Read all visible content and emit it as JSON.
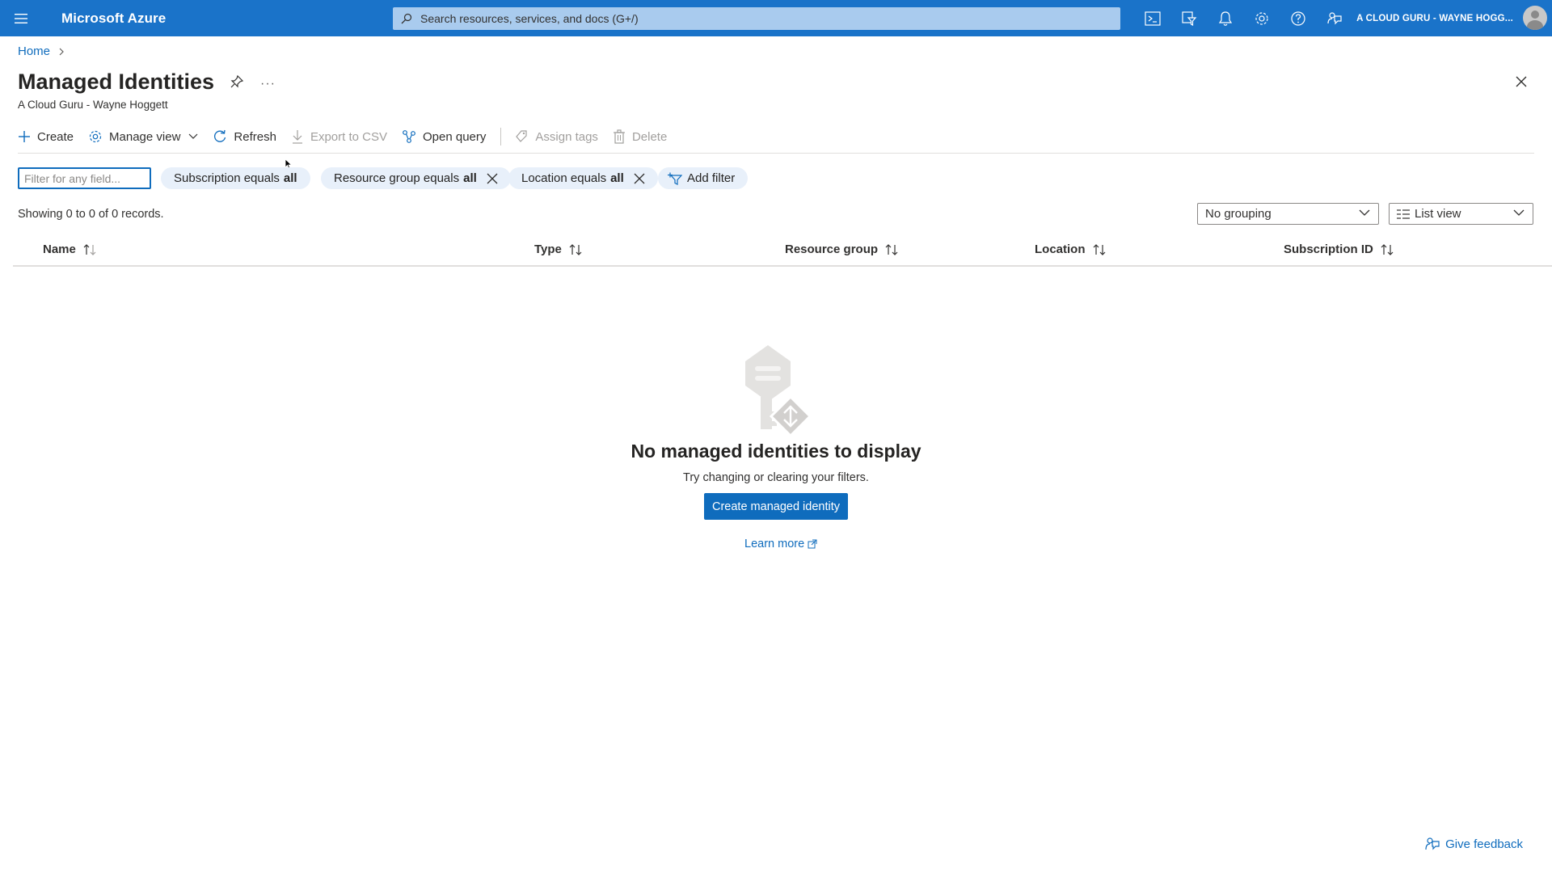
{
  "topbar": {
    "brand": "Microsoft Azure",
    "search_placeholder": "Search resources, services, and docs (G+/)",
    "account": "A CLOUD GURU - WAYNE HOGG...",
    "icons": [
      "cloud-shell-icon",
      "directory-filter-icon",
      "notifications-icon",
      "settings-icon",
      "help-icon",
      "feedback-icon"
    ]
  },
  "breadcrumb": {
    "home": "Home"
  },
  "page": {
    "title": "Managed Identities",
    "subtitle": "A Cloud Guru - Wayne Hoggett",
    "more": "···"
  },
  "commands": {
    "create": "Create",
    "manage_view": "Manage view",
    "refresh": "Refresh",
    "export_csv": "Export to CSV",
    "open_query": "Open query",
    "assign_tags": "Assign tags",
    "delete": "Delete"
  },
  "filters": {
    "placeholder": "Filter for any field...",
    "subscription_label": "Subscription equals",
    "subscription_value": "all",
    "resource_group_label": "Resource group equals",
    "resource_group_value": "all",
    "location_label": "Location equals",
    "location_value": "all",
    "add_filter": "Add filter"
  },
  "records": "Showing 0 to 0 of 0 records.",
  "grouping": {
    "selected": "No grouping"
  },
  "view": {
    "selected": "List view"
  },
  "columns": [
    "Name",
    "Type",
    "Resource group",
    "Location",
    "Subscription ID"
  ],
  "empty_state": {
    "title": "No managed identities to display",
    "subtitle": "Try changing or clearing your filters.",
    "button": "Create managed identity",
    "learn_more": "Learn more"
  },
  "feedback": "Give feedback",
  "colors": {
    "topbar": "#1a73c9",
    "accent": "#0f6cbd",
    "pill_bg": "#e8f0fa"
  }
}
